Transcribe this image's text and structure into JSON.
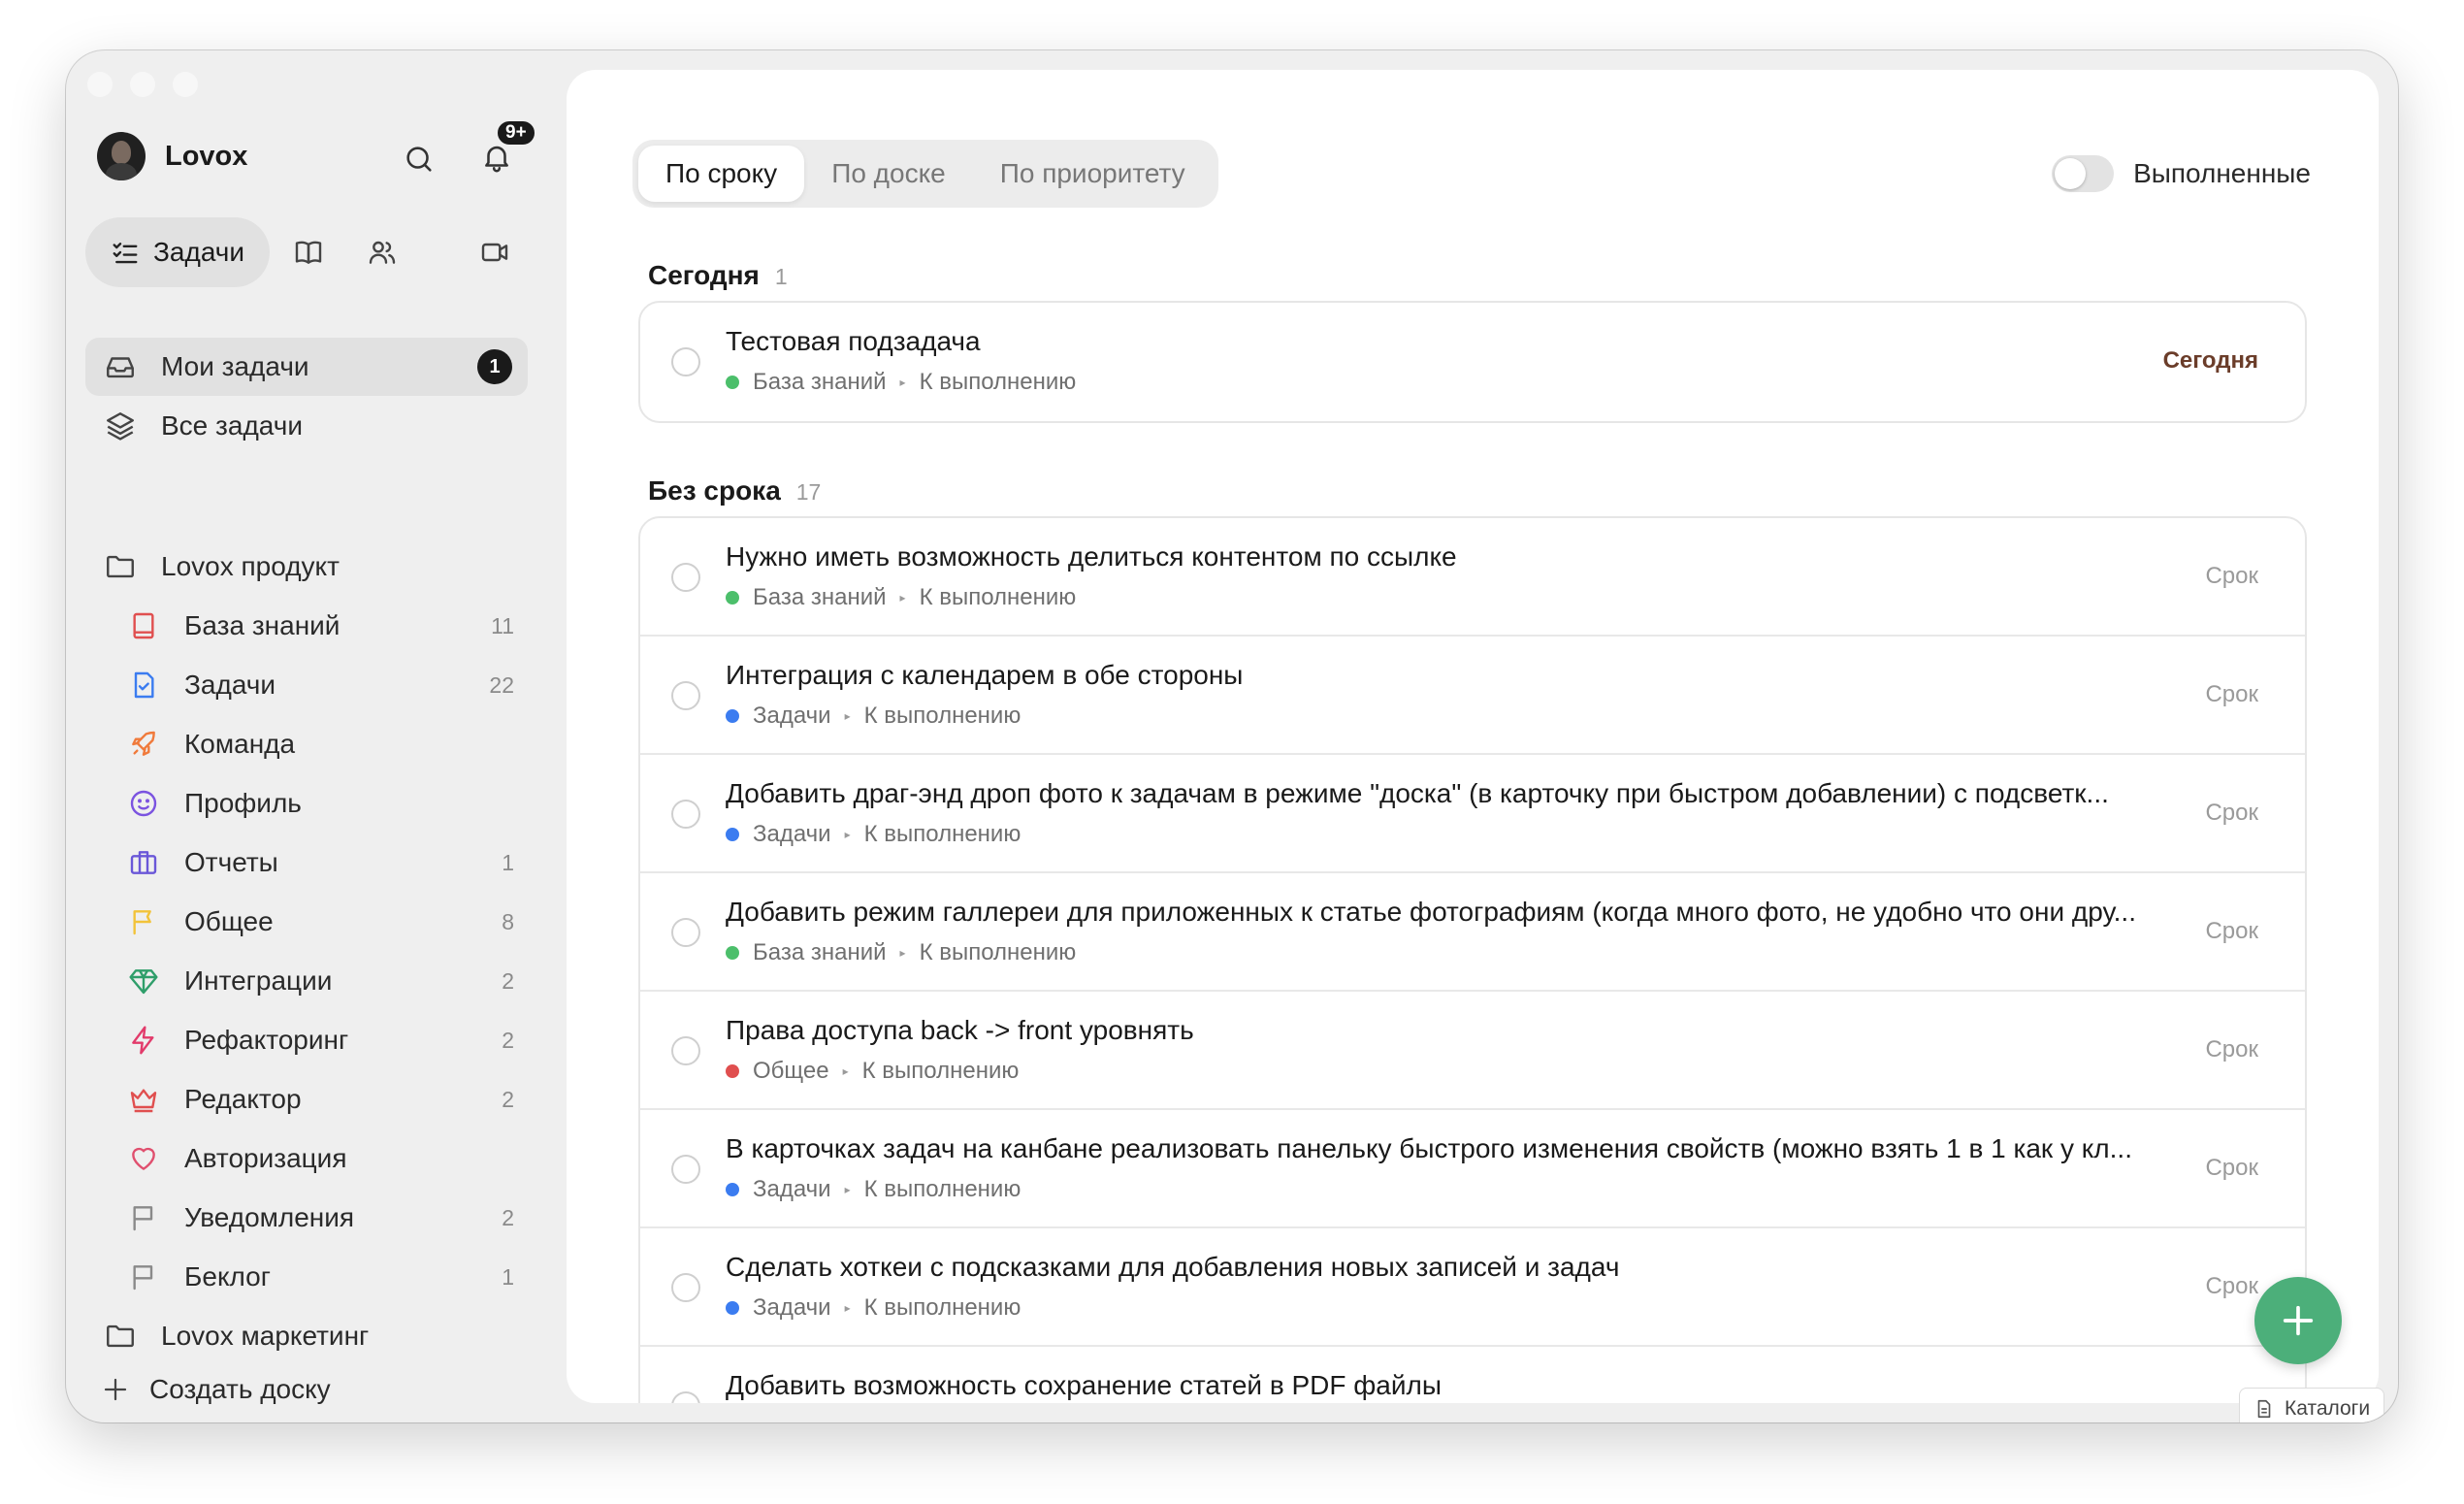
{
  "profile": {
    "name": "Lovox",
    "notifications_badge": "9+"
  },
  "modes": {
    "active_label": "Задачи"
  },
  "nav": {
    "my_tasks": {
      "label": "Мои задачи",
      "count": "1"
    },
    "all_tasks": {
      "label": "Все задачи"
    }
  },
  "folders": {
    "product": "Lovox продукт",
    "marketing": "Lovox маркетинг"
  },
  "boards": [
    {
      "label": "База знаний",
      "count": "11",
      "color": "#e04f4f"
    },
    {
      "label": "Задачи",
      "count": "22",
      "color": "#3b7cf0"
    },
    {
      "label": "Команда",
      "count": "",
      "color": "#f07a3b"
    },
    {
      "label": "Профиль",
      "count": "",
      "color": "#7b53e0"
    },
    {
      "label": "Отчеты",
      "count": "1",
      "color": "#6a57d8"
    },
    {
      "label": "Общее",
      "count": "8",
      "color": "#f2c33a"
    },
    {
      "label": "Интеграции",
      "count": "2",
      "color": "#2f9e6a"
    },
    {
      "label": "Рефакторинг",
      "count": "2",
      "color": "#e23b6b"
    },
    {
      "label": "Редактор",
      "count": "2",
      "color": "#e04f4f"
    },
    {
      "label": "Авторизация",
      "count": "",
      "color": "#e04f6e"
    },
    {
      "label": "Уведомления",
      "count": "2",
      "color": "#8a8a8a"
    },
    {
      "label": "Беклог",
      "count": "1",
      "color": "#8a8a8a"
    }
  ],
  "create_board": "Создать доску",
  "tabs": [
    {
      "label": "По сроку",
      "active": true
    },
    {
      "label": "По доске",
      "active": false
    },
    {
      "label": "По приоритету",
      "active": false
    }
  ],
  "completed_toggle": {
    "label": "Выполненные",
    "on": false
  },
  "sections": {
    "today": {
      "title": "Сегодня",
      "count": "1"
    },
    "no_due": {
      "title": "Без срока",
      "count": "17"
    }
  },
  "today_tasks": [
    {
      "title": "Тестовая подзадача",
      "board": "База знаний",
      "status": "К выполнению",
      "dot": "#4cbf6b",
      "due": "Сегодня"
    }
  ],
  "no_due_tasks": [
    {
      "title": "Нужно иметь возможность делиться контентом по ссылке",
      "board": "База знаний",
      "status": "К выполнению",
      "dot": "#4cbf6b",
      "due": "Срок"
    },
    {
      "title": "Интеграция с календарем в обе стороны",
      "board": "Задачи",
      "status": "К выполнению",
      "dot": "#3b7cf0",
      "due": "Срок"
    },
    {
      "title": "Добавить драг-энд дроп фото к задачам в режиме \"доска\" (в карточку при быстром добавлении) с подсветк...",
      "board": "Задачи",
      "status": "К выполнению",
      "dot": "#3b7cf0",
      "due": "Срок"
    },
    {
      "title": "Добавить режим галлереи для приложенных к статье фотографиям (когда много фото, не удобно что они дру...",
      "board": "База знаний",
      "status": "К выполнению",
      "dot": "#4cbf6b",
      "due": "Срок"
    },
    {
      "title": "Права доступа back -> front уровнять",
      "board": "Общее",
      "status": "К выполнению",
      "dot": "#e04f4f",
      "due": "Срок"
    },
    {
      "title": "В карточках задач на канбане реализовать панельку быстрого изменения свойств (можно взять 1 в 1 как у кл...",
      "board": "Задачи",
      "status": "К выполнению",
      "dot": "#3b7cf0",
      "due": "Срок"
    },
    {
      "title": "Сделать хоткеи с подсказками для добавления новых записей и задач",
      "board": "Задачи",
      "status": "К выполнению",
      "dot": "#3b7cf0",
      "due": "Срок"
    },
    {
      "title": "Добавить возможность сохранение статей в PDF файлы",
      "board": "",
      "status": "",
      "dot": "#3b7cf0",
      "due": ""
    }
  ],
  "catalog_label": "Каталоги",
  "colors": {
    "fab": "#4caf7a",
    "sidebar_bg": "#efefef",
    "active_bg": "#e1e1e1"
  }
}
